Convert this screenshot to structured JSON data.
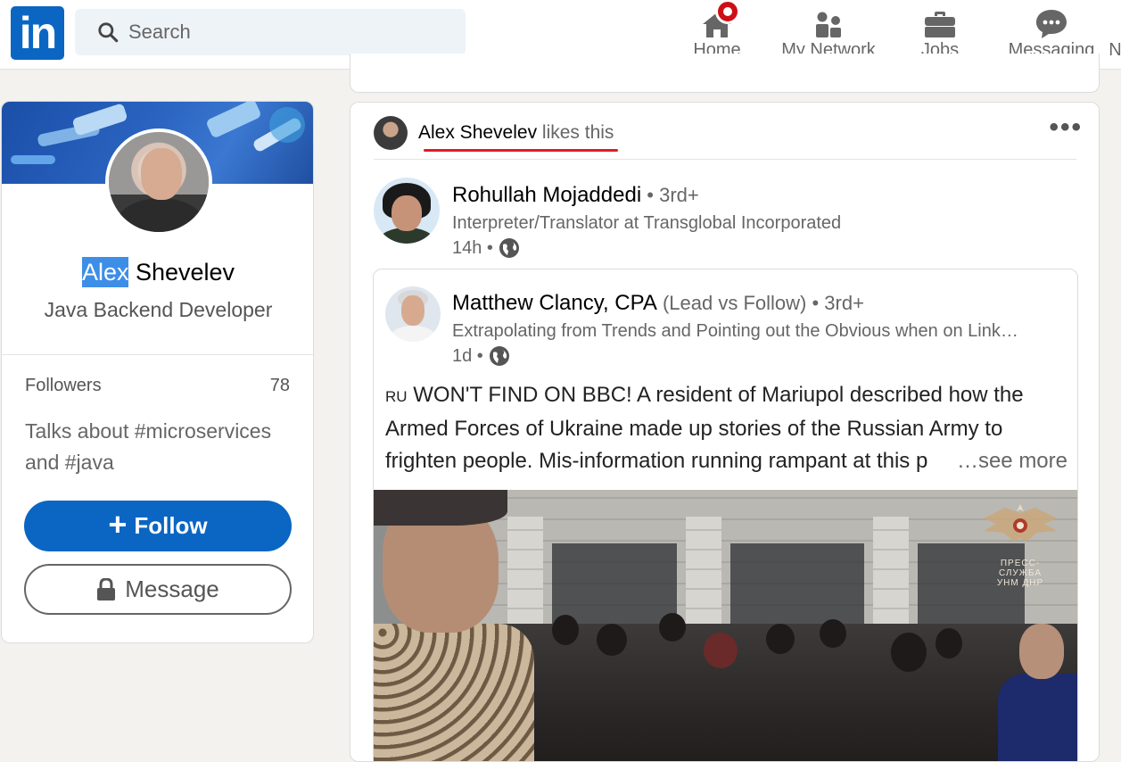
{
  "nav": {
    "logo": "in",
    "search_placeholder": "Search",
    "items": [
      {
        "label": "Home",
        "icon": "home-icon",
        "has_badge": true
      },
      {
        "label": "My Network",
        "icon": "network-icon"
      },
      {
        "label": "Jobs",
        "icon": "briefcase-icon"
      },
      {
        "label": "Messaging",
        "icon": "messaging-icon"
      }
    ],
    "overflow_label": "N"
  },
  "profile": {
    "first_name": "Alex",
    "last_name": " Shevelev",
    "headline": "Java Backend Developer",
    "followers_label": "Followers",
    "followers_count": "78",
    "talks_about": "Talks about #microservices and #java",
    "follow_label": "Follow",
    "follow_icon": "+",
    "message_label": "Message"
  },
  "post": {
    "liker_name": "Alex Shevelev",
    "liker_action": " likes this",
    "more_icon": "•••",
    "author_name": "Rohullah Mojaddedi",
    "author_degree": " • 3rd+",
    "author_headline": "Interpreter/Translator at Transglobal Incorporated",
    "author_time": "14h •",
    "shared": {
      "name": "Matthew Clancy, CPA",
      "name_suffix": " (Lead vs Follow) • 3rd+",
      "headline": "Extrapolating from Trends and Pointing out the Obvious when on Link…",
      "time": "1d •",
      "text_flag": "RU",
      "text_line1": " WON'T FIND ON BBC! A resident of Mariupol described how the",
      "text_line2": "Armed Forces of Ukraine made up stories of the Russian Army to",
      "text_line3": "frighten people. Mis-information running rampant at this p",
      "see_more": "…see more",
      "watermark_line1": "ПРЕСС-СЛУЖБА",
      "watermark_line2": "УНМ ДНР"
    }
  }
}
